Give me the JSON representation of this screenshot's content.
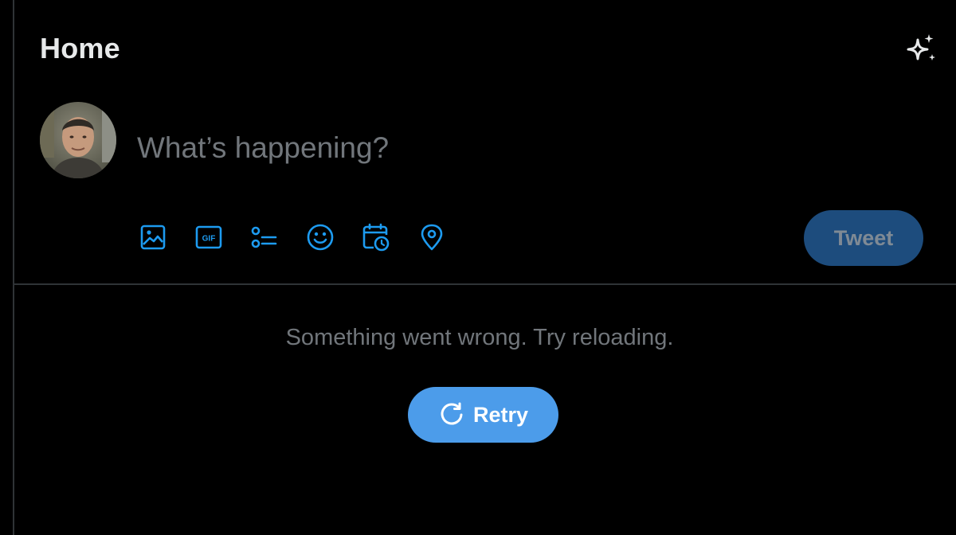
{
  "header": {
    "title": "Home",
    "top_tweets_icon": "sparkle-icon"
  },
  "composer": {
    "avatar_alt": "profile-photo",
    "placeholder": "What’s happening?",
    "tools": [
      {
        "name": "media-icon"
      },
      {
        "name": "gif-icon",
        "label": "GIF"
      },
      {
        "name": "poll-icon"
      },
      {
        "name": "emoji-icon"
      },
      {
        "name": "schedule-icon"
      },
      {
        "name": "location-icon"
      }
    ],
    "tweet_label": "Tweet"
  },
  "feed": {
    "error_message": "Something went wrong. Try reloading.",
    "retry_label": "Retry"
  },
  "colors": {
    "background": "#000000",
    "accent": "#1d9bf0",
    "retry_bg": "#4c9cea",
    "tweet_disabled_bg": "#1d4c7d",
    "muted_text": "#71767b",
    "divider": "#2f3336"
  }
}
